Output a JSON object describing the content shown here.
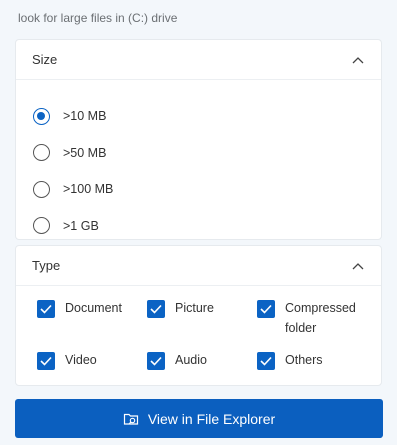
{
  "subtitle": "look for large files in (C:) drive",
  "size": {
    "title": "Size",
    "options": [
      {
        "label": ">10 MB",
        "checked": true
      },
      {
        "label": ">50 MB",
        "checked": false
      },
      {
        "label": ">100 MB",
        "checked": false
      },
      {
        "label": ">1 GB",
        "checked": false
      }
    ]
  },
  "type": {
    "title": "Type",
    "options": [
      {
        "label": "Document",
        "checked": true
      },
      {
        "label": "Picture",
        "checked": true
      },
      {
        "label": "Compressed folder",
        "checked": true
      },
      {
        "label": "Video",
        "checked": true
      },
      {
        "label": "Audio",
        "checked": true
      },
      {
        "label": "Others",
        "checked": true
      }
    ]
  },
  "button": {
    "label": "View in File Explorer",
    "icon": "folder-search-icon"
  },
  "colors": {
    "accent": "#0b63c4",
    "button": "#0b5fbf",
    "background": "#f3f7fb"
  }
}
